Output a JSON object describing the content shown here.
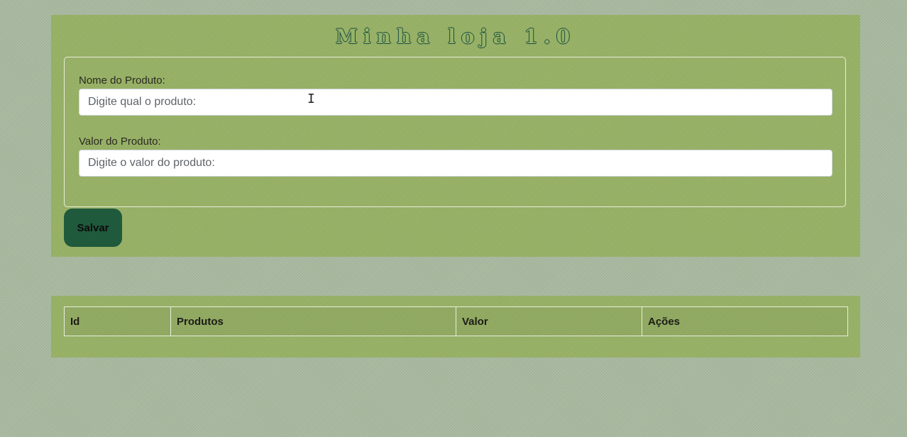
{
  "app": {
    "title": "Minha loja 1.0"
  },
  "form": {
    "name_label": "Nome do Produto:",
    "name_placeholder": "Digite qual o produto:",
    "name_value": "",
    "value_label": "Valor do Produto:",
    "value_placeholder": "Digite o valor do produto:",
    "value_value": "",
    "save_label": "Salvar"
  },
  "table": {
    "columns": [
      "Id",
      "Produtos",
      "Valor",
      "Ações"
    ],
    "rows": []
  },
  "colors": {
    "page_background": "#a9b9a0",
    "panel_background": "#97b165",
    "button_background": "#1f5a3d",
    "title_outline": "#1e4b42"
  }
}
